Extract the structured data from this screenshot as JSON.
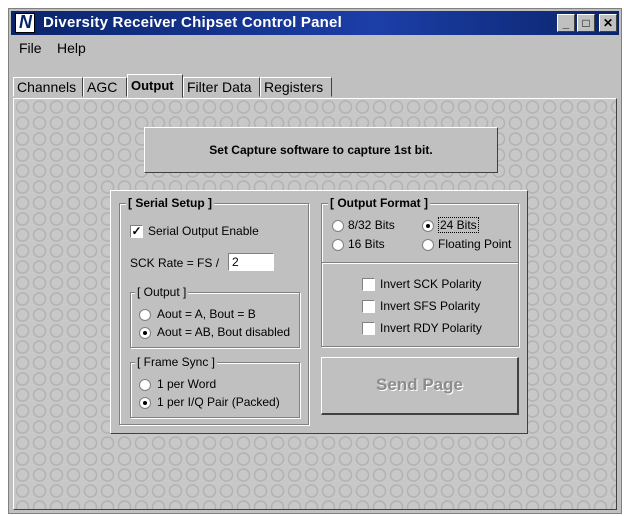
{
  "window": {
    "title": "Diversity Receiver Chipset Control Panel",
    "logo_letter": "N",
    "minimize_glyph": "_",
    "maximize_glyph": "□",
    "close_glyph": "✕"
  },
  "menu": [
    "File",
    "Help"
  ],
  "tabs": [
    "Channels",
    "AGC",
    "Output",
    "Filter Data",
    "Registers"
  ],
  "active_tab": "Output",
  "banner": "Set Capture software to capture 1st bit.",
  "serial_setup": {
    "title": "[ Serial Setup ]",
    "serial_output_enable": {
      "label": "Serial Output Enable",
      "checked": true
    },
    "sck_rate_label": "SCK Rate = FS /",
    "sck_rate_value": "2",
    "output_group": {
      "title": "[ Output ]",
      "options": [
        {
          "label": "Aout = A, Bout = B",
          "selected": false
        },
        {
          "label": "Aout = AB, Bout disabled",
          "selected": true
        }
      ]
    },
    "frame_sync_group": {
      "title": "[ Frame Sync ]",
      "options": [
        {
          "label": "1 per Word",
          "selected": false
        },
        {
          "label": "1 per I/Q Pair (Packed)",
          "selected": true
        }
      ]
    }
  },
  "output_format": {
    "title": "[ Output Format ]",
    "options": [
      {
        "label": "8/32 Bits",
        "selected": false
      },
      {
        "label": "24 Bits",
        "selected": true
      },
      {
        "label": "16 Bits",
        "selected": false
      },
      {
        "label": "Floating Point",
        "selected": false
      }
    ],
    "polarity": [
      {
        "label": "Invert SCK Polarity",
        "checked": false
      },
      {
        "label": "Invert SFS Polarity",
        "checked": false
      },
      {
        "label": "Invert RDY Polarity",
        "checked": false
      }
    ]
  },
  "send_button": "Send Page",
  "colors": {
    "titlebar": "#0a246a",
    "face": "#c0c0c0",
    "disabled_text": "#8c8c8c"
  }
}
